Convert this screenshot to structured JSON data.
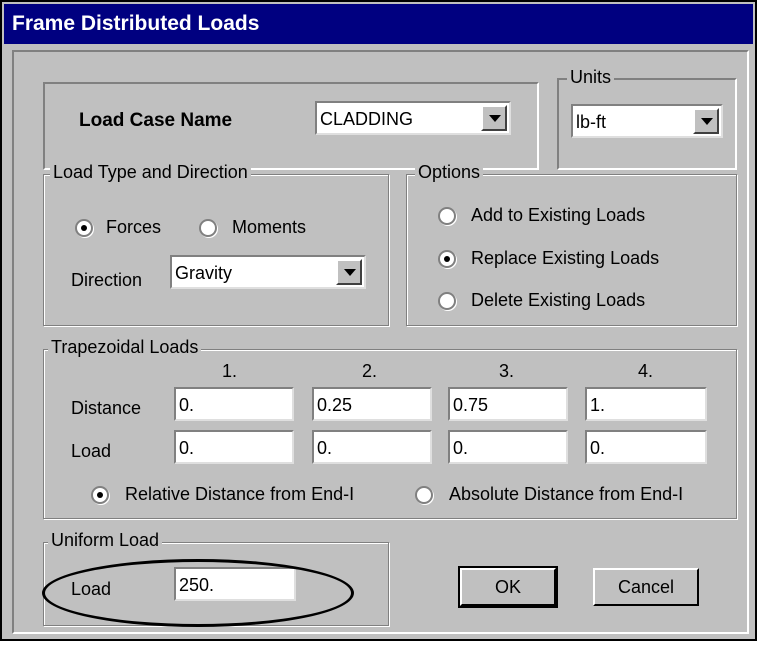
{
  "window": {
    "title": "Frame Distributed Loads"
  },
  "load_case": {
    "label": "Load Case Name",
    "value": "CLADDING"
  },
  "units": {
    "group_label": "Units",
    "value": "lb-ft"
  },
  "load_type": {
    "group_label": "Load Type and Direction",
    "forces_label": "Forces",
    "moments_label": "Moments",
    "selected": "Forces",
    "direction_label": "Direction",
    "direction_value": "Gravity"
  },
  "options": {
    "group_label": "Options",
    "items": [
      "Add to Existing Loads",
      "Replace Existing Loads",
      "Delete Existing Loads"
    ],
    "selected": "Replace Existing Loads"
  },
  "trapezoidal": {
    "group_label": "Trapezoidal Loads",
    "columns": [
      "1.",
      "2.",
      "3.",
      "4."
    ],
    "distance_label": "Distance",
    "distances": [
      "0.",
      "0.25",
      "0.75",
      "1."
    ],
    "load_label": "Load",
    "loads": [
      "0.",
      "0.",
      "0.",
      "0."
    ],
    "relative_label": "Relative Distance from End-I",
    "absolute_label": "Absolute Distance from End-I",
    "selected": "Relative Distance from End-I"
  },
  "uniform": {
    "group_label": "Uniform Load",
    "load_label": "Load",
    "value": "250."
  },
  "buttons": {
    "ok": "OK",
    "cancel": "Cancel"
  }
}
